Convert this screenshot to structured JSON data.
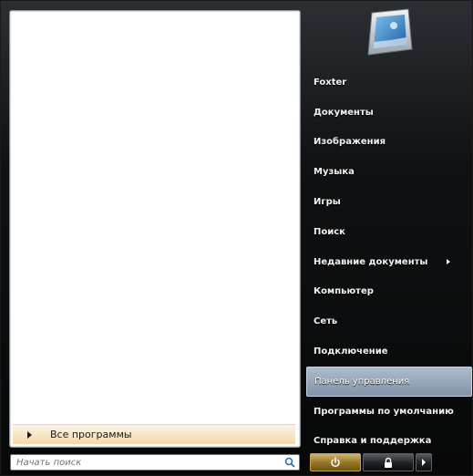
{
  "left_pane": {
    "all_programs_label": "Все программы"
  },
  "search": {
    "placeholder": "Начать поиск"
  },
  "right_pane": {
    "items": [
      {
        "label": "Foxter"
      },
      {
        "label": "Документы"
      },
      {
        "label": "Изображения"
      },
      {
        "label": "Музыка"
      },
      {
        "label": "Игры"
      },
      {
        "label": "Поиск"
      },
      {
        "label": "Недавние документы",
        "has_submenu": true
      },
      {
        "label": "Компьютер"
      },
      {
        "label": "Сеть"
      },
      {
        "label": "Подключение"
      },
      {
        "label": "Панель управления",
        "highlighted": true
      },
      {
        "label": "Программы по умолчанию"
      },
      {
        "label": "Справка и поддержка"
      }
    ]
  },
  "icons": {
    "user_tile": "user-picture-icon",
    "power": "power-icon",
    "lock": "lock-icon",
    "more_options": "arrow-right-icon",
    "search": "search-icon",
    "all_programs": "triangle-right-icon"
  },
  "colors": {
    "menu_background": "#0f1113",
    "highlight": "#8ea0b3",
    "all_programs_bar": "#f3d9a8",
    "power_button": "#9a7a26"
  }
}
